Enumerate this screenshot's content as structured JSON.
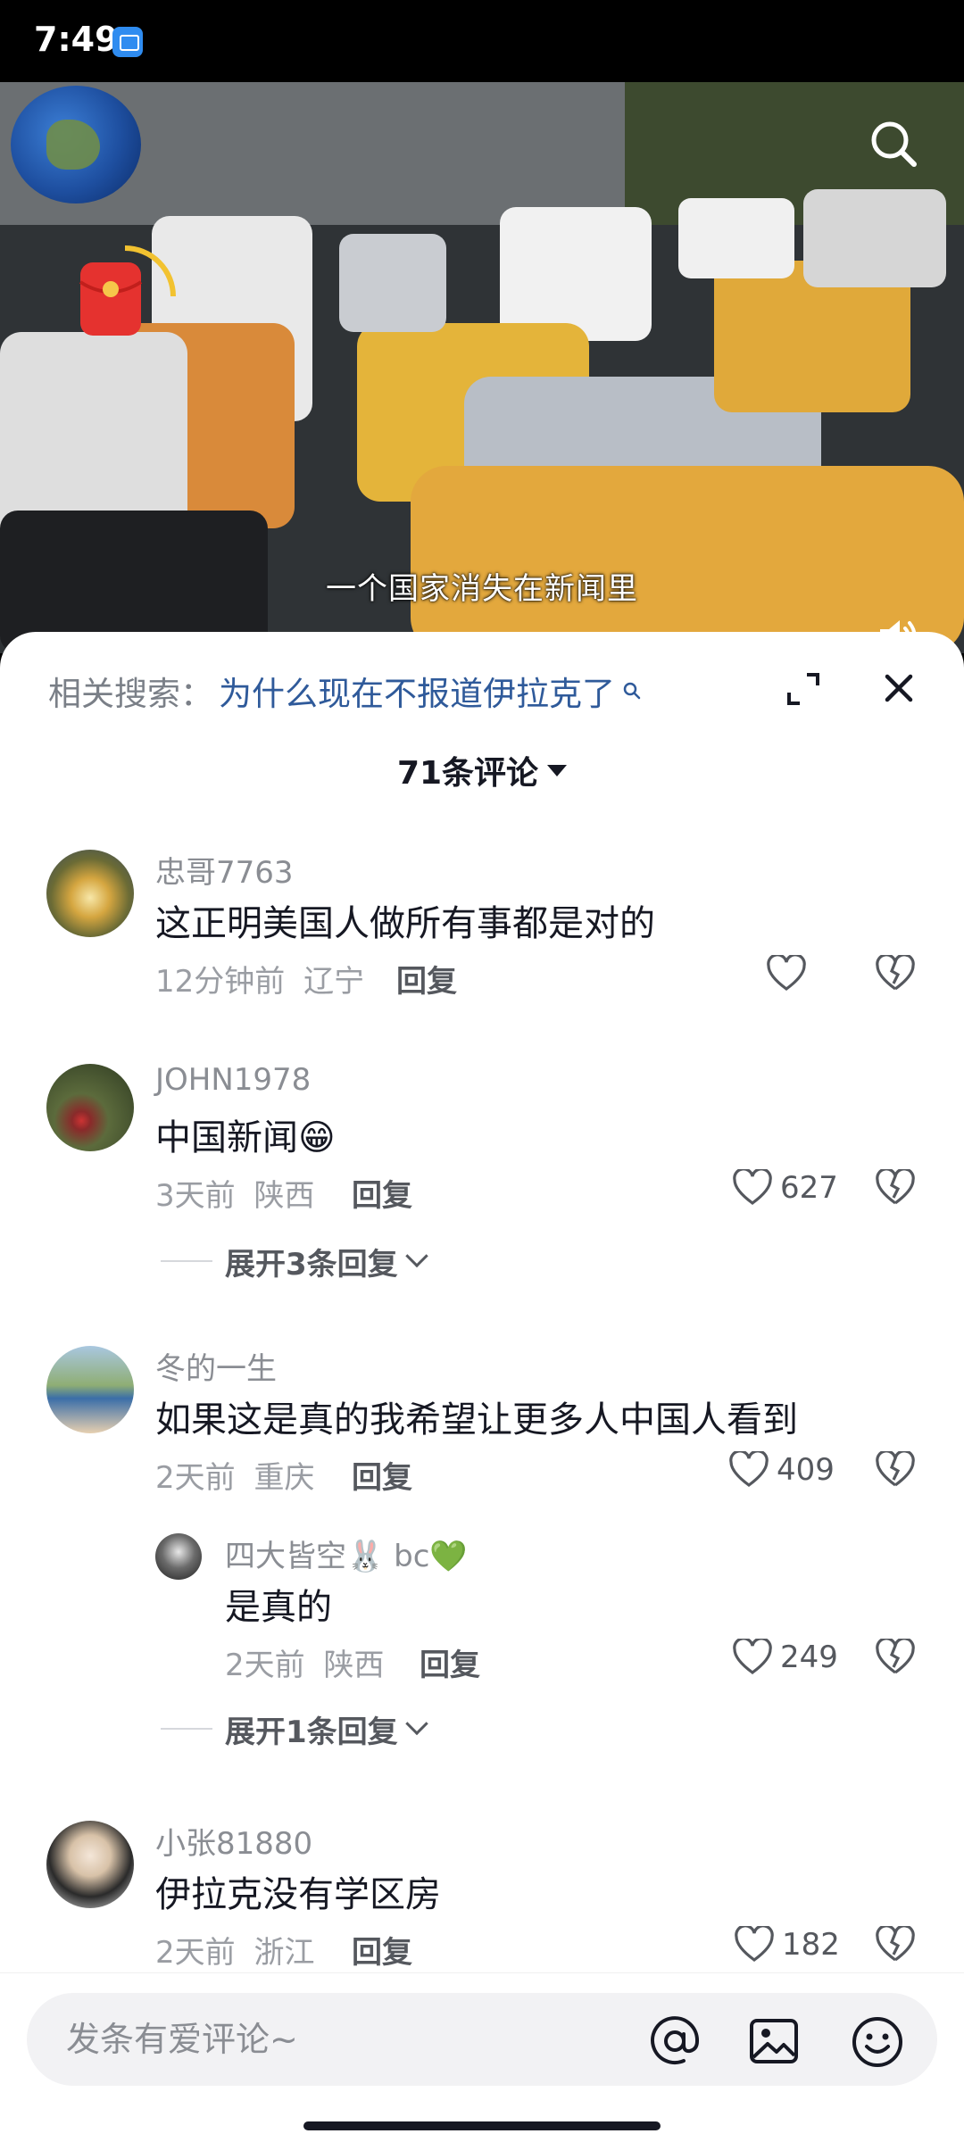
{
  "status_bar": {
    "time": "7:49",
    "app_icon": "mi-app-icon"
  },
  "video": {
    "caption": "一个国家消失在新闻里",
    "icons": [
      "globe-logo-icon",
      "search-icon",
      "red-packet-icon",
      "volume-icon"
    ]
  },
  "panel": {
    "related_label": "相关搜索：",
    "related_query": "为什么现在不报道伊拉克了",
    "comment_count": "71条评论"
  },
  "comments": [
    {
      "username": "忠哥7763",
      "content": "这正明美国人做所有事都是对的",
      "time": "12分钟前",
      "location": "辽宁",
      "reply_label": "回复",
      "likes": ""
    },
    {
      "username": "JOHN1978",
      "content": "中国新闻😁",
      "time": "3天前",
      "location": "陕西",
      "reply_label": "回复",
      "likes": "627",
      "expand": "展开3条回复"
    },
    {
      "username": "冬的一生",
      "content": "如果这是真的我希望让更多人中国人看到",
      "time": "2天前",
      "location": "重庆",
      "reply_label": "回复",
      "likes": "409",
      "reply": {
        "username": "四大皆空🐰 bc💚",
        "content": "是真的",
        "time": "2天前",
        "location": "陕西",
        "reply_label": "回复",
        "likes": "249"
      },
      "expand": "展开1条回复"
    },
    {
      "username": "小张81880",
      "content": "伊拉克没有学区房",
      "time": "2天前",
      "location": "浙江",
      "reply_label": "回复",
      "likes": "182"
    }
  ],
  "input": {
    "placeholder": "发条有爱评论~"
  },
  "colors": {
    "accent_link": "#2f5a9a",
    "text_primary": "#161823",
    "text_secondary": "#8a8d93"
  }
}
